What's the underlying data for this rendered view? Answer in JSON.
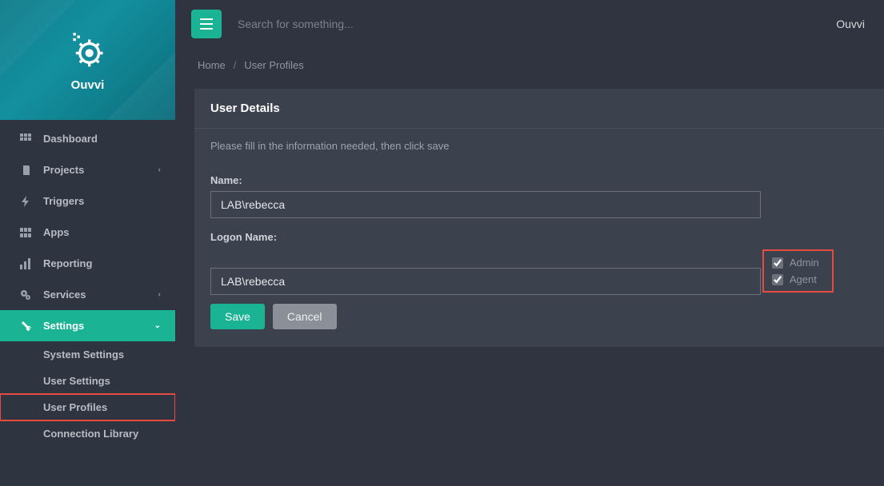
{
  "brand": {
    "name": "Ouvvi"
  },
  "topbar": {
    "search_placeholder": "Search for something...",
    "right_label": "Ouvvi"
  },
  "breadcrumbs": {
    "home": "Home",
    "current": "User Profiles"
  },
  "sidebar": {
    "items": [
      {
        "label": "Dashboard",
        "icon": "grid"
      },
      {
        "label": "Projects",
        "icon": "book",
        "chevron": "left"
      },
      {
        "label": "Triggers",
        "icon": "bolt"
      },
      {
        "label": "Apps",
        "icon": "th"
      },
      {
        "label": "Reporting",
        "icon": "bar"
      },
      {
        "label": "Services",
        "icon": "cogs",
        "chevron": "left"
      },
      {
        "label": "Settings",
        "icon": "wrench",
        "chevron": "down",
        "active": true
      }
    ],
    "settings_submenu": [
      {
        "label": "System Settings"
      },
      {
        "label": "User Settings"
      },
      {
        "label": "User Profiles",
        "highlighted": true
      },
      {
        "label": "Connection Library"
      }
    ]
  },
  "panel": {
    "title": "User Details",
    "note": "Please fill in the information needed, then click save",
    "fields": {
      "name_label": "Name:",
      "name_value": "LAB\\rebecca",
      "logon_label": "Logon Name:",
      "logon_value": "LAB\\rebecca"
    },
    "checks": {
      "admin_label": "Admin",
      "admin_checked": true,
      "agent_label": "Agent",
      "agent_checked": true
    },
    "buttons": {
      "save": "Save",
      "cancel": "Cancel"
    }
  },
  "colors": {
    "accent": "#1ab394",
    "highlight": "#e74b3e"
  }
}
